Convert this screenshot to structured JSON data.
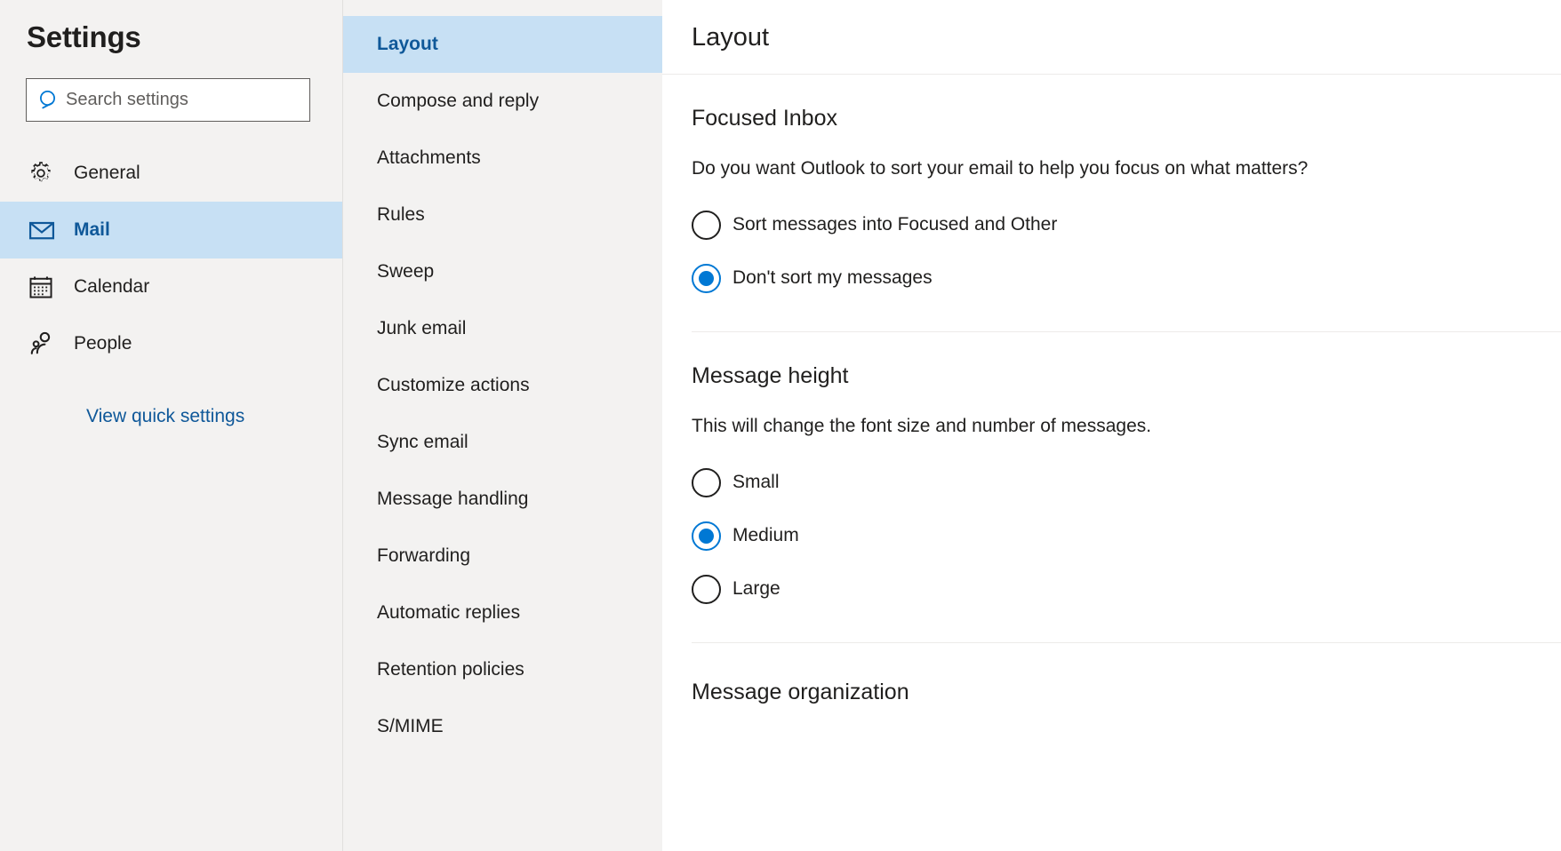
{
  "sidebar": {
    "title": "Settings",
    "search": {
      "placeholder": "Search settings",
      "value": "",
      "icon": "search-icon"
    },
    "items": [
      {
        "label": "General",
        "icon": "gear-icon",
        "selected": false
      },
      {
        "label": "Mail",
        "icon": "envelope-icon",
        "selected": true
      },
      {
        "label": "Calendar",
        "icon": "calendar-icon",
        "selected": false
      },
      {
        "label": "People",
        "icon": "people-icon",
        "selected": false
      }
    ],
    "quick_settings_link": "View quick settings"
  },
  "subnav": {
    "items": [
      {
        "label": "Layout",
        "selected": true
      },
      {
        "label": "Compose and reply",
        "selected": false
      },
      {
        "label": "Attachments",
        "selected": false
      },
      {
        "label": "Rules",
        "selected": false
      },
      {
        "label": "Sweep",
        "selected": false
      },
      {
        "label": "Junk email",
        "selected": false
      },
      {
        "label": "Customize actions",
        "selected": false
      },
      {
        "label": "Sync email",
        "selected": false
      },
      {
        "label": "Message handling",
        "selected": false
      },
      {
        "label": "Forwarding",
        "selected": false
      },
      {
        "label": "Automatic replies",
        "selected": false
      },
      {
        "label": "Retention policies",
        "selected": false
      },
      {
        "label": "S/MIME",
        "selected": false
      }
    ]
  },
  "main": {
    "header_title": "Layout",
    "sections": {
      "focused_inbox": {
        "title": "Focused Inbox",
        "description": "Do you want Outlook to sort your email to help you focus on what matters?",
        "options": [
          {
            "label": "Sort messages into Focused and Other",
            "checked": false
          },
          {
            "label": "Don't sort my messages",
            "checked": true
          }
        ]
      },
      "message_height": {
        "title": "Message height",
        "description": "This will change the font size and number of messages.",
        "options": [
          {
            "label": "Small",
            "checked": false
          },
          {
            "label": "Medium",
            "checked": true
          },
          {
            "label": "Large",
            "checked": false
          }
        ]
      },
      "message_organization": {
        "title": "Message organization"
      }
    }
  },
  "colors": {
    "accent": "#0078d4",
    "accent_text": "#0f5899",
    "selection_bg": "#c7e0f4",
    "chrome_bg": "#f3f2f1",
    "panel_bg": "#ffffff",
    "text": "#201f1e",
    "divider": "#edebe9"
  }
}
